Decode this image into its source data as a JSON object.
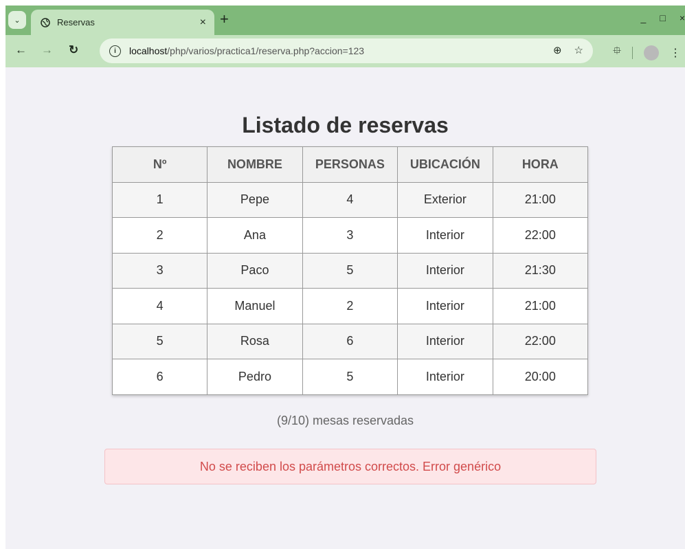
{
  "browser": {
    "tab_title": "Reservas",
    "tab_close": "×",
    "new_tab": "+",
    "url_host": "localhost",
    "url_path": "/php/varios/practica1/reserva.php?accion=123",
    "minimize": "_",
    "maximize": "□",
    "close": "×"
  },
  "page": {
    "title": "Listado de reservas",
    "table": {
      "headers": [
        "Nº",
        "NOMBRE",
        "PERSONAS",
        "UBICACIÓN",
        "HORA"
      ],
      "rows": [
        [
          "1",
          "Pepe",
          "4",
          "Exterior",
          "21:00"
        ],
        [
          "2",
          "Ana",
          "3",
          "Interior",
          "22:00"
        ],
        [
          "3",
          "Paco",
          "5",
          "Interior",
          "21:30"
        ],
        [
          "4",
          "Manuel",
          "2",
          "Interior",
          "21:00"
        ],
        [
          "5",
          "Rosa",
          "6",
          "Interior",
          "22:00"
        ],
        [
          "6",
          "Pedro",
          "5",
          "Interior",
          "20:00"
        ]
      ]
    },
    "status": "(9/10) mesas reservadas",
    "error": "No se reciben los parámetros correctos. Error genérico"
  }
}
